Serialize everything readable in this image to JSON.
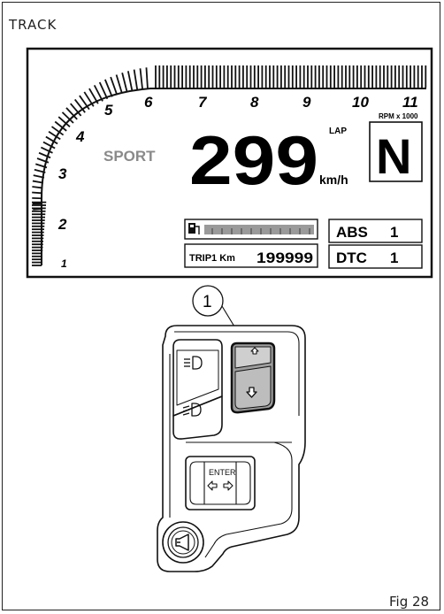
{
  "header": {
    "section": "TRACK"
  },
  "dashboard": {
    "rpm_ticks": [
      "1",
      "2",
      "3",
      "4",
      "5",
      "6",
      "7",
      "8",
      "9",
      "10",
      "11"
    ],
    "rpm_unit": "RPM x 1000",
    "mode": "SPORT",
    "speed": "299",
    "speed_unit": "km/h",
    "lap_label": "LAP",
    "gear": "N",
    "trip_label": "TRIP1 Km",
    "trip_value": "199999",
    "abs_label": "ABS",
    "abs_value": "1",
    "dtc_label": "DTC",
    "dtc_value": "1",
    "fuel_icon": "fuel-pump-icon"
  },
  "switchgear": {
    "callout_number": "1",
    "enter_label": "ENTER",
    "up_button_icon": "arrow-up-icon",
    "down_button_icon": "arrow-down-icon",
    "high_beam_icon": "high-beam-icon",
    "low_beam_icon": "low-beam-icon",
    "horn_icon": "horn-icon",
    "left_arrow_icon": "arrow-left-icon",
    "right_arrow_icon": "arrow-right-icon"
  },
  "footer": {
    "figure": "Fig 28"
  }
}
